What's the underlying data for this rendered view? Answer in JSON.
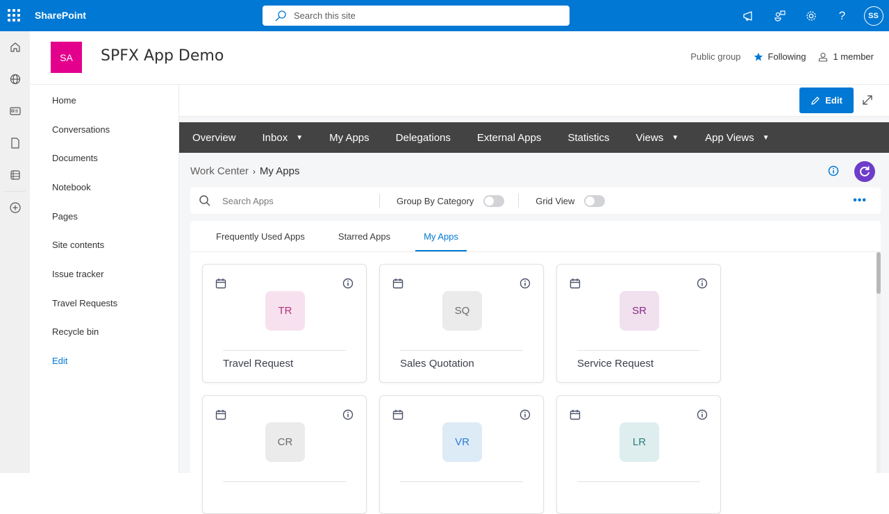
{
  "suite_bar": {
    "brand": "SharePoint",
    "search_placeholder": "Search this site",
    "avatar_initials": "SS"
  },
  "site": {
    "logo_initials": "SA",
    "title": "SPFX App Demo",
    "privacy": "Public group",
    "following_label": "Following",
    "members_label": "1 member"
  },
  "left_nav": {
    "items": [
      "Home",
      "Conversations",
      "Documents",
      "Notebook",
      "Pages",
      "Site contents",
      "Issue tracker",
      "Travel Requests",
      "Recycle bin"
    ],
    "edit_label": "Edit"
  },
  "command_bar": {
    "edit_label": "Edit"
  },
  "app_nav": {
    "items": [
      {
        "label": "Overview",
        "dropdown": false
      },
      {
        "label": "Inbox",
        "dropdown": true
      },
      {
        "label": "My Apps",
        "dropdown": false
      },
      {
        "label": "Delegations",
        "dropdown": false
      },
      {
        "label": "External Apps",
        "dropdown": false
      },
      {
        "label": "Statistics",
        "dropdown": false
      },
      {
        "label": "Views",
        "dropdown": true
      },
      {
        "label": "App Views",
        "dropdown": true
      }
    ],
    "caret": "▼"
  },
  "breadcrumb": {
    "root": "Work Center",
    "separator": "›",
    "current": "My Apps"
  },
  "toolbar": {
    "search_placeholder": "Search Apps",
    "search_value": "",
    "group_by_label": "Group By Category",
    "group_by_on": false,
    "grid_view_label": "Grid View",
    "grid_view_on": false,
    "more_label": "•••"
  },
  "tabs": {
    "items": [
      "Frequently Used Apps",
      "Starred Apps",
      "My Apps"
    ],
    "active_index": 2
  },
  "apps": [
    {
      "initials": "TR",
      "name": "Travel Request",
      "bg": "#f7e1ef",
      "fg": "#b3307a"
    },
    {
      "initials": "SQ",
      "name": "Sales Quotation",
      "bg": "#ebebeb",
      "fg": "#6b6b6b"
    },
    {
      "initials": "SR",
      "name": "Service Request",
      "bg": "#f1e1ef",
      "fg": "#8a2a82"
    },
    {
      "initials": "CR",
      "name": "",
      "bg": "#ebebeb",
      "fg": "#6b6b6b"
    },
    {
      "initials": "VR",
      "name": "",
      "bg": "#ddebf7",
      "fg": "#2b7cd3"
    },
    {
      "initials": "LR",
      "name": "",
      "bg": "#deeeee",
      "fg": "#2e7b7b"
    }
  ],
  "colors": {
    "suite_blue": "#0078d4",
    "site_logo": "#e3008c",
    "app_nav_bg": "#444343",
    "refresh_purple": "#6e3cc9",
    "active_tab": "#0078d4"
  }
}
